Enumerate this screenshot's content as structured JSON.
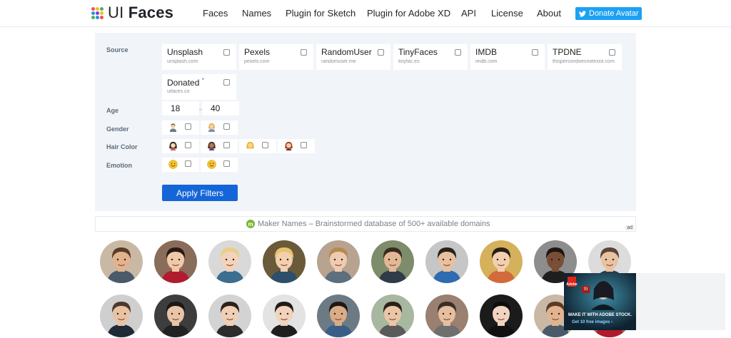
{
  "brand": {
    "logo_light": "UI ",
    "logo_bold": "Faces",
    "dot_colors": [
      "#f1504b",
      "#f9b82b",
      "#47b650",
      "#2b8ded",
      "#7b3fd0",
      "#f9b82b",
      "#47b650",
      "#2b8ded",
      "#f1504b"
    ]
  },
  "nav": [
    "Faces",
    "Names",
    "Plugin for Sketch",
    "Plugin for Adobe XD",
    "API",
    "License",
    "About"
  ],
  "donate": {
    "label": "Donate Avatar",
    "icon": "twitter-bird-icon",
    "color": "#1da1f2"
  },
  "filters": {
    "source_label": "Source",
    "sources": [
      {
        "name": "Unsplash",
        "domain": "unsplash.com"
      },
      {
        "name": "Pexels",
        "domain": "pexels.com"
      },
      {
        "name": "RandomUser",
        "domain": "randomuser.me"
      },
      {
        "name": "TinyFaces",
        "domain": "tinyfac.es"
      },
      {
        "name": "IMDB",
        "domain": "imdb.com"
      },
      {
        "name": "TPDNE",
        "domain": "thispersondoesnotexist.com"
      },
      {
        "name": "Donated",
        "domain": "uifaces.co",
        "mark": "*"
      }
    ],
    "age_label": "Age",
    "age_from": "18",
    "age_separator": "–",
    "age_to": "40",
    "gender_label": "Gender",
    "gender_options": [
      "male-emoji-icon",
      "female-emoji-icon"
    ],
    "hair_label": "Hair Color",
    "hair_options": [
      "black-hair-emoji-icon",
      "brown-hair-emoji-icon",
      "blond-hair-emoji-icon",
      "red-hair-emoji-icon"
    ],
    "emotion_label": "Emotion",
    "emotion_options": [
      "happy-emoji-icon",
      "neutral-emoji-icon"
    ],
    "apply_label": "Apply Filters",
    "accent": "#1466d8"
  },
  "ad_line": {
    "icon_letter": "m",
    "text": "Maker Names – Brainstormed database of 500+ available domains",
    "badge": "ad"
  },
  "adobe_ad": {
    "logo": "Adobe",
    "app": "St",
    "line1": "MAKE IT WITH ADOBE STOCK.",
    "line2": "Get 10 free images ›"
  }
}
